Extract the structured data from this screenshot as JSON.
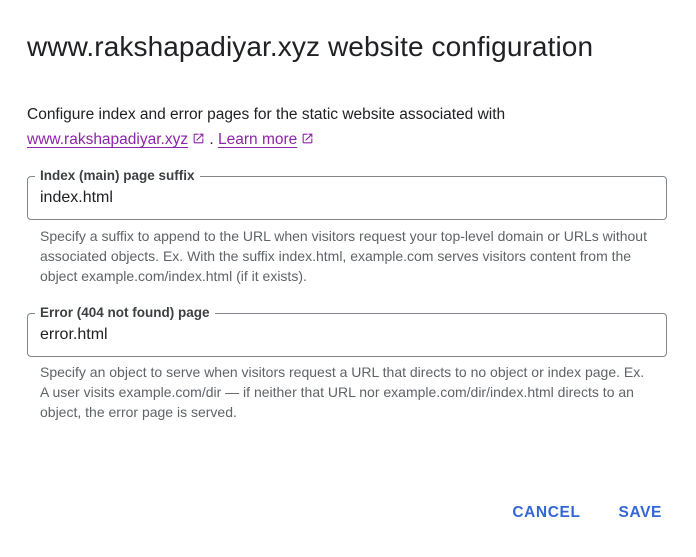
{
  "dialog": {
    "title": "www.rakshapadiyar.xyz website configuration",
    "description": "Configure index and error pages for the static website associated with",
    "domain_link": "www.rakshapadiyar.xyz",
    "separator": ".",
    "learn_more": "Learn more",
    "link_icon": "open-in-new-icon",
    "link_color": "#8e24aa"
  },
  "index_field": {
    "label": "Index (main) page suffix",
    "value": "index.html",
    "hint": "Specify a suffix to append to the URL when visitors request your top-level domain or URLs without associated objects. Ex. With the suffix index.html, example.com serves visitors content from the object example.com/index.html (if it exists)."
  },
  "error_field": {
    "label": "Error (404 not found) page",
    "value": "error.html",
    "hint": "Specify an object to serve when visitors request a URL that directs to no object or index page. Ex. A user visits example.com/dir — if neither that URL nor example.com/dir/index.html directs to an object, the error page is served."
  },
  "actions": {
    "cancel": "CANCEL",
    "save": "SAVE",
    "accent_color": "#3367d6"
  }
}
